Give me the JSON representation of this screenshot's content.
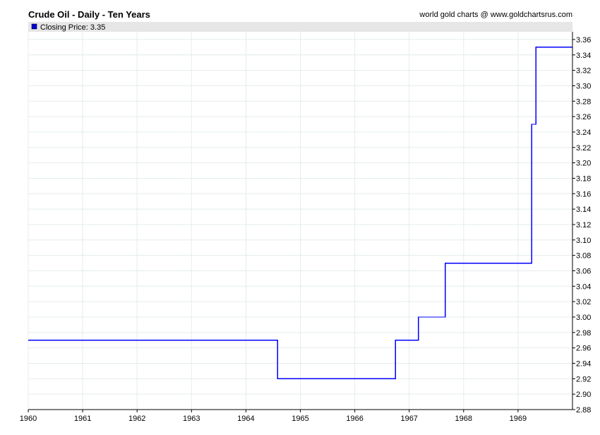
{
  "header": {
    "title": "Crude Oil - Daily - Ten Years",
    "source": "world gold charts @ www.goldchartsrus.com"
  },
  "legend": {
    "label": "Closing Price: 3.35"
  },
  "chart_data": {
    "type": "line",
    "title": "Crude Oil - Daily - Ten Years",
    "xlabel": "",
    "ylabel": "",
    "x_axis_type": "year",
    "xlim": [
      1960.0,
      1970.0
    ],
    "ylim": [
      2.88,
      3.37
    ],
    "y_axis_position": "right",
    "grid": true,
    "legend_position": "top-left",
    "x_ticks": [
      "1960",
      "1961",
      "1962",
      "1963",
      "1964",
      "1965",
      "1966",
      "1967",
      "1968",
      "1969"
    ],
    "y_ticks": [
      "2.88",
      "2.90",
      "2.92",
      "2.94",
      "2.96",
      "2.98",
      "3.00",
      "3.02",
      "3.04",
      "3.06",
      "3.08",
      "3.10",
      "3.12",
      "3.14",
      "3.16",
      "3.18",
      "3.20",
      "3.22",
      "3.24",
      "3.26",
      "3.28",
      "3.30",
      "3.32",
      "3.34",
      "3.36"
    ],
    "step": true,
    "series": [
      {
        "name": "Closing Price",
        "color": "#0000ff",
        "x": [
          1960.0,
          1964.58,
          1966.75,
          1967.17,
          1967.66,
          1969.25,
          1969.33,
          1970.0
        ],
        "values": [
          2.97,
          2.92,
          2.97,
          3.0,
          3.07,
          3.25,
          3.35,
          3.35
        ]
      }
    ]
  }
}
